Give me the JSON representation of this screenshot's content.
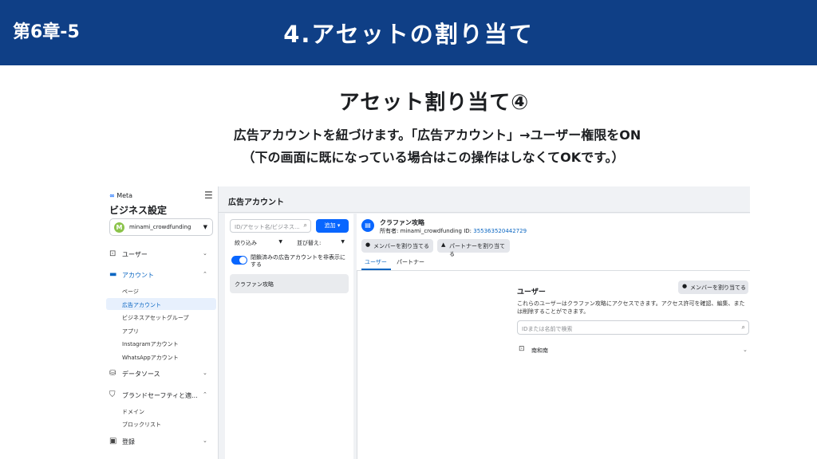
{
  "banner": {
    "chapter": "第6章-5",
    "title": "4.アセットの割り当て"
  },
  "slide": {
    "heading": "アセット割り当て④",
    "instruction1": "広告アカウントを紐づけます。「広告アカウント」→ユーザー権限をON",
    "instruction2": "（下の画面に既になっている場合はこの操作はしなくてOKです。）"
  },
  "colors": {
    "banner": "#0f3f86",
    "accent": "#0866ff",
    "link": "#0a66c2"
  },
  "app": {
    "logo": "Meta",
    "title": "ビジネス設定",
    "account": {
      "initial": "M",
      "name": "minami_crowdfunding"
    },
    "sidebar": {
      "users": "ユーザー",
      "accounts": "アカウント",
      "account_items": [
        "ページ",
        "広告アカウント",
        "ビジネスアセットグループ",
        "アプリ",
        "Instagramアカウント",
        "WhatsAppアカウント"
      ],
      "datasources": "データソース",
      "brandsafety": "ブランドセーフティと適...",
      "brandsafety_items": [
        "ドメイン",
        "ブロックリスト"
      ],
      "registration": "登録"
    },
    "page_title": "広告アカウント",
    "list": {
      "search_placeholder": "ID/アセット名/ビジネス...",
      "add_button": "追加",
      "filter_label": "絞り込み",
      "sort_label": "並び替え:",
      "toggle_label": "閉鎖済みの広告アカウントを非表示にする",
      "rows": [
        "クラファン攻略"
      ]
    },
    "detail": {
      "asset_name": "クラファン攻略",
      "owner_prefix": "所有者: minami_crowdfunding  ID: ",
      "owner_id": "355363520442729",
      "assign_member_button": "メンバーを割り当てる",
      "assign_partner_button": "パートナーを割り当てる",
      "tabs": [
        "ユーザー",
        "パートナー"
      ],
      "users_title": "ユーザー",
      "users_assign_button": "メンバーを割り当てる",
      "users_desc": "これらのユーザーはクラファン攻略にアクセスできます。アクセス許可を確認、編集、または削除することができます。",
      "users_search_placeholder": "IDまたは名前で検索",
      "user_name": "南和南"
    }
  }
}
